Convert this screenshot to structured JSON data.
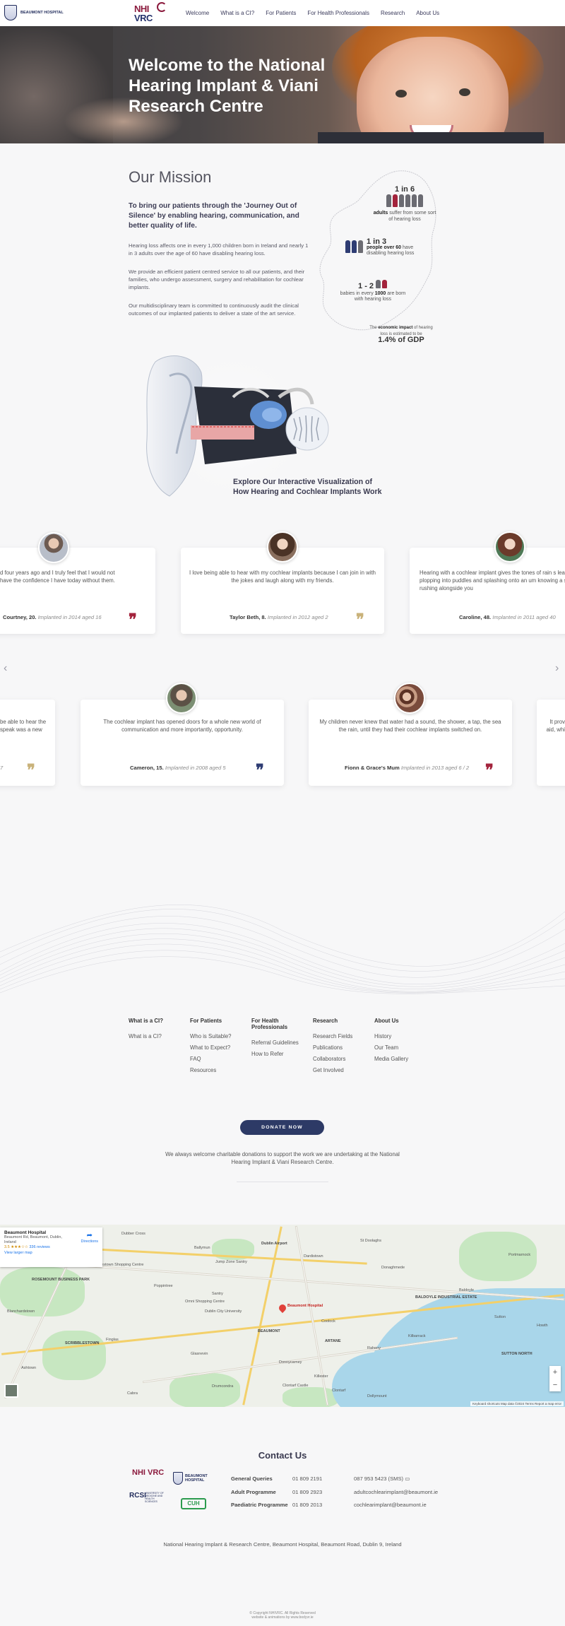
{
  "nav": {
    "bh_logo_text": "BEAUMONT HOSPITAL",
    "nhi_logo": {
      "line1": "NHI",
      "line2": "VRC"
    },
    "items": [
      "Welcome",
      "What is a CI?",
      "For Patients",
      "For Health Professionals",
      "Research",
      "About Us"
    ]
  },
  "hero": {
    "title": "Welcome to the National Hearing Implant & Viani Research Centre"
  },
  "mission": {
    "heading": "Our Mission",
    "lead": "To bring our patients through the 'Journey Out of Silence' by enabling hearing, communication, and better quality of life.",
    "paragraphs": [
      "Hearing loss affects one in every 1,000 children born in Ireland and nearly 1 in 3 adults over the age of 60 have disabling hearing loss.",
      "We provide an efficient patient centred service to all our patients, and their families, who undergo assessment, surgery and rehabilitation for cochlear implants.",
      "Our multidisciplinary team is committed to continuously audit the clinical outcomes of our implanted patients to deliver a state of the art service."
    ],
    "stats": [
      {
        "big": "1 in 6",
        "bold": "adults",
        "text": "suffer from some sort of hearing loss"
      },
      {
        "big": "1 in 3",
        "bold": "people over 60",
        "text": "have disabling hearing loss"
      },
      {
        "big": "1 - 2",
        "pre": "babies in every",
        "bold": "1000",
        "text": "are born with hearing loss"
      },
      {
        "pre": "The",
        "bold": "economic impact",
        "text": "of hearing loss is estimated to be",
        "big": "1.4% of GDP"
      }
    ]
  },
  "visualization": {
    "title": "Explore Our Interactive Visualization of How Hearing and Cochlear Implants Work"
  },
  "testimonials": {
    "row1": [
      {
        "quote": "d four years ago and I truly feel that I would not have the confidence I have today without them.",
        "name": "Courtney, 20.",
        "detail": "Implanted in 2014 aged 16",
        "quote_color": "#a3233c"
      },
      {
        "quote": "I love being able to hear with my cochlear implants because I can join in with the jokes and laugh along with my friends.",
        "name": "Taylor Beth, 8.",
        "detail": "Implanted in 2012 aged 2",
        "quote_color": "#c9b27a"
      },
      {
        "quote": "Hearing with a cochlear implant gives the tones of rain s leaves, plopping into puddles and splashing onto an um knowing a stream is rushing alongside you",
        "name": "Caroline, 48.",
        "detail": "Implanted in 2011 aged 40",
        "quote_color": "#a3233c"
      }
    ],
    "row2": [
      {
        "quote": "be able to hear the speak was a new",
        "name": "",
        "detail": "7",
        "quote_color": "#c9b27a"
      },
      {
        "quote": "The cochlear implant has opened doors for a whole new world of communication and more importantly, opportunity.",
        "name": "Cameron, 15.",
        "detail": "Implanted in 2008 aged 5",
        "quote_color": "#2e3c73"
      },
      {
        "quote": "My children never knew that water had a sound, the shower, a tap, the sea the rain, until they had their cochlear implants switched on.",
        "name": "Fionn & Grace's Mum",
        "detail": "Implanted in 2013 aged 6 / 2",
        "quote_color": "#a3233c"
      },
      {
        "quote": "It prov aid, whi",
        "name": "",
        "detail": "",
        "quote_color": "#a3233c"
      }
    ],
    "prev": "‹",
    "next": "›"
  },
  "footer_links": [
    {
      "heading": "What is a CI?",
      "items": [
        "What is a CI?"
      ]
    },
    {
      "heading": "For Patients",
      "items": [
        "Who is Suitable?",
        "What to Expect?",
        "FAQ",
        "Resources"
      ]
    },
    {
      "heading": "For Health Professionals",
      "items": [
        "Referral Guidelines",
        "How to Refer"
      ]
    },
    {
      "heading": "Research",
      "items": [
        "Research Fields",
        "Publications",
        "Collaborators",
        "Get Involved"
      ]
    },
    {
      "heading": "About Us",
      "items": [
        "History",
        "Our Team",
        "Media Gallery"
      ]
    }
  ],
  "donate": {
    "button": "DONATE NOW",
    "text": "We always welcome charitable donations to support the work we are undertaking at the National Hearing Implant & Viani Research Centre."
  },
  "map": {
    "place": "Beaumont Hospital",
    "address": "Beaumont Rd, Beaumont, Dublin, Ireland",
    "rating": "3.5",
    "stars": "★★★☆☆",
    "reviews": "336 reviews",
    "larger": "View larger map",
    "directions": "Directions",
    "pin_label": "Beaumont Hospital",
    "labels": [
      "Dubber Cross",
      "Dublin Airport",
      "St Doolaghs",
      "ROSEMOUNT BUSINESS PARK",
      "Charlestown Shopping Centre",
      "Donaghmede",
      "Santry",
      "Coolock",
      "Raheny",
      "Dublin City University",
      "BEAUMONT",
      "ARTANE",
      "Kilbarrack",
      "Sutton",
      "Howth",
      "Finglas",
      "Glasnevin",
      "Cabra",
      "Drumcondra",
      "Donnycarney",
      "Killester",
      "Clontarf",
      "Dollymount",
      "BALDOYLE INDUSTRIAL ESTATE",
      "Baldoyle",
      "Portmarnock",
      "SUTTON NORTH",
      "Ballymun",
      "Poppintree",
      "Blanchardstown",
      "Clontarf Castle",
      "Jump Zone Santry",
      "Dardistown",
      "SCRIBBLESTOWN",
      "Ashtown",
      "Omni Shopping Centre"
    ],
    "zoom_in": "+",
    "zoom_out": "−",
    "footer": "Keyboard shortcuts   Map data ©2024   Terms   Report a map error"
  },
  "contact": {
    "heading": "Contact Us",
    "rows": [
      {
        "label": "General Queries",
        "phone": "01 809 2191",
        "extra": "087 953 5423 (SMS)"
      },
      {
        "label": "Adult Programme",
        "phone": "01 809 2923",
        "extra": "adultcochlearimplant@beaumont.ie"
      },
      {
        "label": "Paediatric Programme",
        "phone": "01 809 2013",
        "extra": "cochlearimplant@beaumont.ie"
      }
    ],
    "logos": [
      "NHI VRC",
      "BEAUMONT HOSPITAL",
      "RCSI",
      "UNIVERSITY OF MEDICINE AND HEALTH SCIENCES",
      "CUH"
    ],
    "address": "National Hearing Implant & Research Centre, Beaumont Hospital, Beaumont Road, Dublin 9, Ireland"
  },
  "copyright": {
    "line1": "© Copyright NHIVRC. All Rights Reserved",
    "line2": "website & animations by www.bodyvr.ie"
  }
}
